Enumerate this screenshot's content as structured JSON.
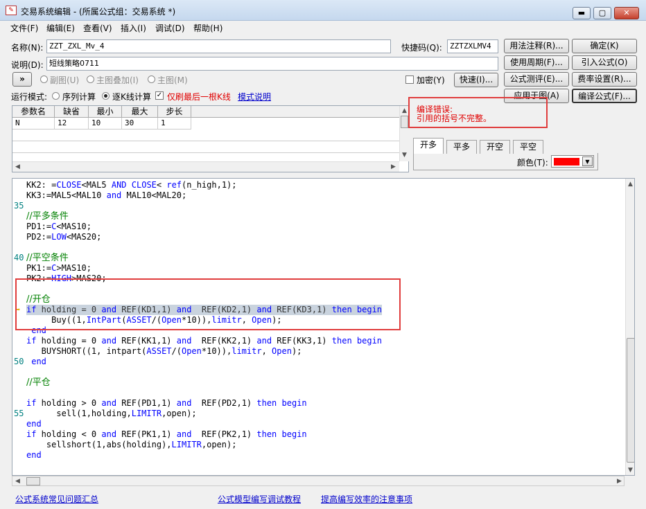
{
  "window": {
    "title": "交易系统编辑 - (所属公式组：交易系统 *)",
    "min": "▬",
    "max": "▢",
    "close": "✕"
  },
  "menu": [
    "文件(F)",
    "编辑(E)",
    "查看(V)",
    "插入(I)",
    "调试(D)",
    "帮助(H)"
  ],
  "form": {
    "name_label": "名称(N):",
    "name_value": "ZZT_ZXL_Mv_4",
    "shortcut_label": "快捷码(Q):",
    "shortcut_value": "ZZTZXLMV4",
    "desc_label": "说明(D):",
    "desc_value": "短线策略0711",
    "expand": "»",
    "sub_chart": "副图(U)",
    "main_overlay": "主图叠加(I)",
    "main_chart": "主图(M)",
    "encrypt": "加密(Y)",
    "run_mode_label": "运行模式:",
    "serial_calc": "序列计算",
    "bar_calc": "逐K线计算",
    "last_bar_only": "仅刷最后一根K线",
    "mode_help": "模式说明"
  },
  "buttons": {
    "usage": "用法注释(R)...",
    "confirm": "确定(K)",
    "period": "使用周期(F)...",
    "import": "引入公式(O)",
    "quick": "快速(I)...",
    "test": "公式测评(E)...",
    "fee": "费率设置(R)...",
    "apply": "应用于图(A)",
    "compile": "编译公式(F)..."
  },
  "params": {
    "headers": [
      "参数名",
      "缺省",
      "最小",
      "最大",
      "步长"
    ],
    "rows": [
      [
        "N",
        "12",
        "10",
        "30",
        "1"
      ]
    ]
  },
  "error": {
    "line1": "编译错误:",
    "line2": "引用的括号不完整。"
  },
  "signal_tabs": [
    "开多",
    "平多",
    "开空",
    "平空"
  ],
  "color_label": "颜色(T):",
  "colors": {
    "signal": "#ff0000",
    "error": "#e00000",
    "keyword": "#0000ff",
    "comment": "#008000",
    "line_number": "#008080"
  },
  "code_lines": [
    {
      "n": "",
      "t": "KK2: =CLOSE<MAL5 AND CLOSE< ref(n_high,1);"
    },
    {
      "n": "",
      "t": "KK3:=MAL5<MAL10 and MAL10<MAL20;"
    },
    {
      "n": "35",
      "t": ""
    },
    {
      "n": "",
      "t": "//平多条件"
    },
    {
      "n": "",
      "t": "PD1:=C<MAS10;"
    },
    {
      "n": "",
      "t": "PD2:=LOW<MAS20;"
    },
    {
      "n": "",
      "t": ""
    },
    {
      "n": "40",
      "t": "//平空条件"
    },
    {
      "n": "",
      "t": "PK1:=C>MAS10;"
    },
    {
      "n": "",
      "t": "PK2:=HIGH>MAS20;"
    },
    {
      "n": "",
      "t": ""
    },
    {
      "n": "",
      "t": "//开仓"
    },
    {
      "n": "",
      "t": "if holding = 0 and REF(KD1,1) and  REF(KD2,1) and REF(KD3,1) then begin"
    },
    {
      "n": "",
      "t": "     Buy((1,IntPart(ASSET/(Open*10)),limitr, Open);"
    },
    {
      "n": "",
      "t": " end"
    },
    {
      "n": "",
      "t": "if holding = 0 and REF(KK1,1) and  REF(KK2,1) and REF(KK3,1) then begin"
    },
    {
      "n": "",
      "t": "   BUYSHORT((1, intpart(ASSET/(Open*10)),limitr, Open);"
    },
    {
      "n": "50",
      "t": " end"
    },
    {
      "n": "",
      "t": ""
    },
    {
      "n": "",
      "t": "//平仓"
    },
    {
      "n": "",
      "t": ""
    },
    {
      "n": "",
      "t": "if holding > 0 and REF(PD1,1) and  REF(PD2,1) then begin"
    },
    {
      "n": "55",
      "t": "      sell(1,holding,LIMITR,open);"
    },
    {
      "n": "",
      "t": "end"
    },
    {
      "n": "",
      "t": "if holding < 0 and REF(PK1,1) and  REF(PK2,1) then begin"
    },
    {
      "n": "",
      "t": "    sellshort(1,abs(holding),LIMITR,open);"
    },
    {
      "n": "",
      "t": "end"
    }
  ],
  "footer": {
    "faq": "公式系统常见问题汇总",
    "tutorial": "公式模型编写调试教程",
    "tips": "提高编写效率的注意事项"
  }
}
